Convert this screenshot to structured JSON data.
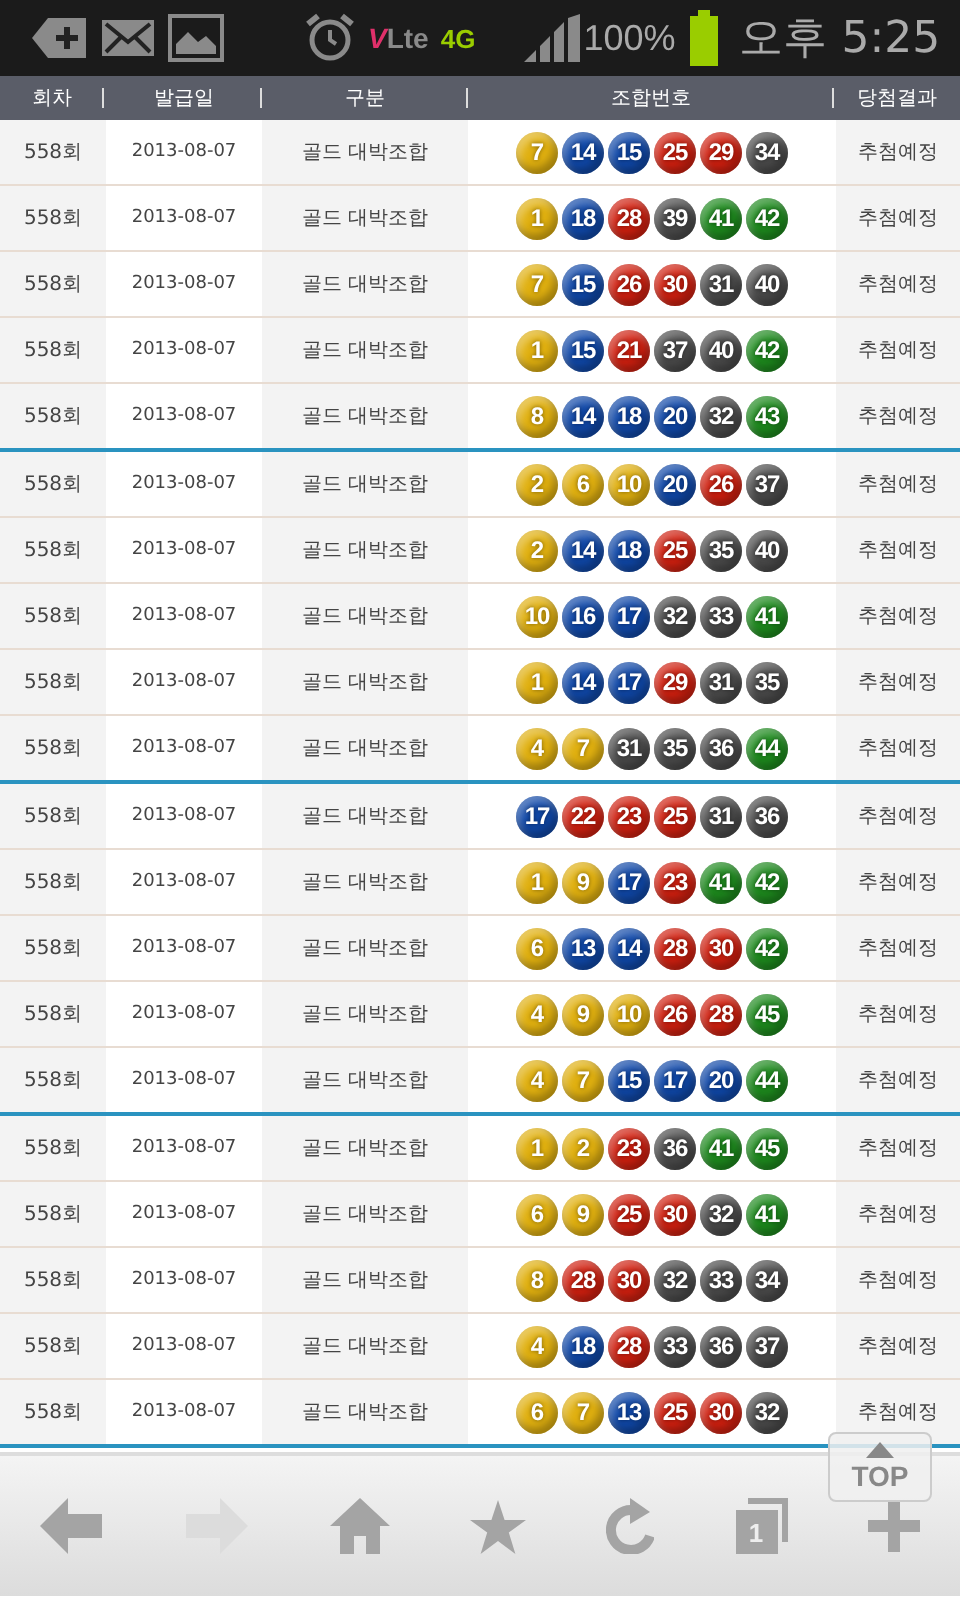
{
  "status_bar": {
    "volte_mark": "V",
    "lte_label": "Lte",
    "network": "4G",
    "battery": "100%",
    "time": "오후 5:25"
  },
  "table": {
    "columns": [
      "회차",
      "발급일",
      "구분",
      "조합번호",
      "당첨결과"
    ],
    "groups": [
      {
        "rows": [
          {
            "round": "558회",
            "date": "2013-08-07",
            "type": "골드 대박조합",
            "balls": [
              {
                "n": "7",
                "color": "#e0b010"
              },
              {
                "n": "14",
                "color": "#1048a8"
              },
              {
                "n": "15",
                "color": "#1048a8"
              },
              {
                "n": "25",
                "color": "#d02010"
              },
              {
                "n": "29",
                "color": "#d02010"
              },
              {
                "n": "34",
                "color": "#4a4a4a"
              }
            ],
            "result": "추첨예정"
          },
          {
            "round": "558회",
            "date": "2013-08-07",
            "type": "골드 대박조합",
            "balls": [
              {
                "n": "1",
                "color": "#e0b010"
              },
              {
                "n": "18",
                "color": "#1048a8"
              },
              {
                "n": "28",
                "color": "#d02010"
              },
              {
                "n": "39",
                "color": "#4a4a4a"
              },
              {
                "n": "41",
                "color": "#1e8a1e"
              },
              {
                "n": "42",
                "color": "#1e8a1e"
              }
            ],
            "result": "추첨예정"
          },
          {
            "round": "558회",
            "date": "2013-08-07",
            "type": "골드 대박조합",
            "balls": [
              {
                "n": "7",
                "color": "#e0b010"
              },
              {
                "n": "15",
                "color": "#1048a8"
              },
              {
                "n": "26",
                "color": "#d02010"
              },
              {
                "n": "30",
                "color": "#d02010"
              },
              {
                "n": "31",
                "color": "#4a4a4a"
              },
              {
                "n": "40",
                "color": "#4a4a4a"
              }
            ],
            "result": "추첨예정"
          },
          {
            "round": "558회",
            "date": "2013-08-07",
            "type": "골드 대박조합",
            "balls": [
              {
                "n": "1",
                "color": "#e0b010"
              },
              {
                "n": "15",
                "color": "#1048a8"
              },
              {
                "n": "21",
                "color": "#d02010"
              },
              {
                "n": "37",
                "color": "#4a4a4a"
              },
              {
                "n": "40",
                "color": "#4a4a4a"
              },
              {
                "n": "42",
                "color": "#1e8a1e"
              }
            ],
            "result": "추첨예정"
          },
          {
            "round": "558회",
            "date": "2013-08-07",
            "type": "골드 대박조합",
            "balls": [
              {
                "n": "8",
                "color": "#e0b010"
              },
              {
                "n": "14",
                "color": "#1048a8"
              },
              {
                "n": "18",
                "color": "#1048a8"
              },
              {
                "n": "20",
                "color": "#1048a8"
              },
              {
                "n": "32",
                "color": "#4a4a4a"
              },
              {
                "n": "43",
                "color": "#1e8a1e"
              }
            ],
            "result": "추첨예정"
          }
        ]
      },
      {
        "rows": [
          {
            "round": "558회",
            "date": "2013-08-07",
            "type": "골드 대박조합",
            "balls": [
              {
                "n": "2",
                "color": "#e0b010"
              },
              {
                "n": "6",
                "color": "#e0b010"
              },
              {
                "n": "10",
                "color": "#e0b010"
              },
              {
                "n": "20",
                "color": "#1048a8"
              },
              {
                "n": "26",
                "color": "#d02010"
              },
              {
                "n": "37",
                "color": "#4a4a4a"
              }
            ],
            "result": "추첨예정"
          },
          {
            "round": "558회",
            "date": "2013-08-07",
            "type": "골드 대박조합",
            "balls": [
              {
                "n": "2",
                "color": "#e0b010"
              },
              {
                "n": "14",
                "color": "#1048a8"
              },
              {
                "n": "18",
                "color": "#1048a8"
              },
              {
                "n": "25",
                "color": "#d02010"
              },
              {
                "n": "35",
                "color": "#4a4a4a"
              },
              {
                "n": "40",
                "color": "#4a4a4a"
              }
            ],
            "result": "추첨예정"
          },
          {
            "round": "558회",
            "date": "2013-08-07",
            "type": "골드 대박조합",
            "balls": [
              {
                "n": "10",
                "color": "#e0b010"
              },
              {
                "n": "16",
                "color": "#1048a8"
              },
              {
                "n": "17",
                "color": "#1048a8"
              },
              {
                "n": "32",
                "color": "#4a4a4a"
              },
              {
                "n": "33",
                "color": "#4a4a4a"
              },
              {
                "n": "41",
                "color": "#1e8a1e"
              }
            ],
            "result": "추첨예정"
          },
          {
            "round": "558회",
            "date": "2013-08-07",
            "type": "골드 대박조합",
            "balls": [
              {
                "n": "1",
                "color": "#e0b010"
              },
              {
                "n": "14",
                "color": "#1048a8"
              },
              {
                "n": "17",
                "color": "#1048a8"
              },
              {
                "n": "29",
                "color": "#d02010"
              },
              {
                "n": "31",
                "color": "#4a4a4a"
              },
              {
                "n": "35",
                "color": "#4a4a4a"
              }
            ],
            "result": "추첨예정"
          },
          {
            "round": "558회",
            "date": "2013-08-07",
            "type": "골드 대박조합",
            "balls": [
              {
                "n": "4",
                "color": "#e0b010"
              },
              {
                "n": "7",
                "color": "#e0b010"
              },
              {
                "n": "31",
                "color": "#4a4a4a"
              },
              {
                "n": "35",
                "color": "#4a4a4a"
              },
              {
                "n": "36",
                "color": "#4a4a4a"
              },
              {
                "n": "44",
                "color": "#1e8a1e"
              }
            ],
            "result": "추첨예정"
          }
        ]
      },
      {
        "rows": [
          {
            "round": "558회",
            "date": "2013-08-07",
            "type": "골드 대박조합",
            "balls": [
              {
                "n": "17",
                "color": "#1048a8"
              },
              {
                "n": "22",
                "color": "#d02010"
              },
              {
                "n": "23",
                "color": "#d02010"
              },
              {
                "n": "25",
                "color": "#d02010"
              },
              {
                "n": "31",
                "color": "#4a4a4a"
              },
              {
                "n": "36",
                "color": "#4a4a4a"
              }
            ],
            "result": "추첨예정"
          },
          {
            "round": "558회",
            "date": "2013-08-07",
            "type": "골드 대박조합",
            "balls": [
              {
                "n": "1",
                "color": "#e0b010"
              },
              {
                "n": "9",
                "color": "#e0b010"
              },
              {
                "n": "17",
                "color": "#1048a8"
              },
              {
                "n": "23",
                "color": "#d02010"
              },
              {
                "n": "41",
                "color": "#1e8a1e"
              },
              {
                "n": "42",
                "color": "#1e8a1e"
              }
            ],
            "result": "추첨예정"
          },
          {
            "round": "558회",
            "date": "2013-08-07",
            "type": "골드 대박조합",
            "balls": [
              {
                "n": "6",
                "color": "#e0b010"
              },
              {
                "n": "13",
                "color": "#1048a8"
              },
              {
                "n": "14",
                "color": "#1048a8"
              },
              {
                "n": "28",
                "color": "#d02010"
              },
              {
                "n": "30",
                "color": "#d02010"
              },
              {
                "n": "42",
                "color": "#1e8a1e"
              }
            ],
            "result": "추첨예정"
          },
          {
            "round": "558회",
            "date": "2013-08-07",
            "type": "골드 대박조합",
            "balls": [
              {
                "n": "4",
                "color": "#e0b010"
              },
              {
                "n": "9",
                "color": "#e0b010"
              },
              {
                "n": "10",
                "color": "#e0b010"
              },
              {
                "n": "26",
                "color": "#d02010"
              },
              {
                "n": "28",
                "color": "#d02010"
              },
              {
                "n": "45",
                "color": "#1e8a1e"
              }
            ],
            "result": "추첨예정"
          },
          {
            "round": "558회",
            "date": "2013-08-07",
            "type": "골드 대박조합",
            "balls": [
              {
                "n": "4",
                "color": "#e0b010"
              },
              {
                "n": "7",
                "color": "#e0b010"
              },
              {
                "n": "15",
                "color": "#1048a8"
              },
              {
                "n": "17",
                "color": "#1048a8"
              },
              {
                "n": "20",
                "color": "#1048a8"
              },
              {
                "n": "44",
                "color": "#1e8a1e"
              }
            ],
            "result": "추첨예정"
          }
        ]
      },
      {
        "rows": [
          {
            "round": "558회",
            "date": "2013-08-07",
            "type": "골드 대박조합",
            "balls": [
              {
                "n": "1",
                "color": "#e0b010"
              },
              {
                "n": "2",
                "color": "#e0b010"
              },
              {
                "n": "23",
                "color": "#d02010"
              },
              {
                "n": "36",
                "color": "#4a4a4a"
              },
              {
                "n": "41",
                "color": "#1e8a1e"
              },
              {
                "n": "45",
                "color": "#1e8a1e"
              }
            ],
            "result": "추첨예정"
          },
          {
            "round": "558회",
            "date": "2013-08-07",
            "type": "골드 대박조합",
            "balls": [
              {
                "n": "6",
                "color": "#e0b010"
              },
              {
                "n": "9",
                "color": "#e0b010"
              },
              {
                "n": "25",
                "color": "#d02010"
              },
              {
                "n": "30",
                "color": "#d02010"
              },
              {
                "n": "32",
                "color": "#4a4a4a"
              },
              {
                "n": "41",
                "color": "#1e8a1e"
              }
            ],
            "result": "추첨예정"
          },
          {
            "round": "558회",
            "date": "2013-08-07",
            "type": "골드 대박조합",
            "balls": [
              {
                "n": "8",
                "color": "#e0b010"
              },
              {
                "n": "28",
                "color": "#d02010"
              },
              {
                "n": "30",
                "color": "#d02010"
              },
              {
                "n": "32",
                "color": "#4a4a4a"
              },
              {
                "n": "33",
                "color": "#4a4a4a"
              },
              {
                "n": "34",
                "color": "#4a4a4a"
              }
            ],
            "result": "추첨예정"
          },
          {
            "round": "558회",
            "date": "2013-08-07",
            "type": "골드 대박조합",
            "balls": [
              {
                "n": "4",
                "color": "#e0b010"
              },
              {
                "n": "18",
                "color": "#1048a8"
              },
              {
                "n": "28",
                "color": "#d02010"
              },
              {
                "n": "33",
                "color": "#4a4a4a"
              },
              {
                "n": "36",
                "color": "#4a4a4a"
              },
              {
                "n": "37",
                "color": "#4a4a4a"
              }
            ],
            "result": "추첨예정"
          },
          {
            "round": "558회",
            "date": "2013-08-07",
            "type": "골드 대박조합",
            "balls": [
              {
                "n": "6",
                "color": "#e0b010"
              },
              {
                "n": "7",
                "color": "#e0b010"
              },
              {
                "n": "13",
                "color": "#1048a8"
              },
              {
                "n": "25",
                "color": "#d02010"
              },
              {
                "n": "30",
                "color": "#d02010"
              },
              {
                "n": "32",
                "color": "#4a4a4a"
              }
            ],
            "result": "추첨예정"
          }
        ]
      }
    ]
  },
  "top_button": {
    "label": "TOP"
  },
  "toolbar": [
    {
      "kind": "back",
      "disabled": false
    },
    {
      "kind": "forward",
      "disabled": true
    },
    {
      "kind": "home",
      "disabled": false
    },
    {
      "kind": "bookmark",
      "disabled": false
    },
    {
      "kind": "refresh",
      "disabled": false
    },
    {
      "kind": "tabs",
      "disabled": false,
      "count": "1"
    },
    {
      "kind": "new",
      "disabled": false
    }
  ]
}
